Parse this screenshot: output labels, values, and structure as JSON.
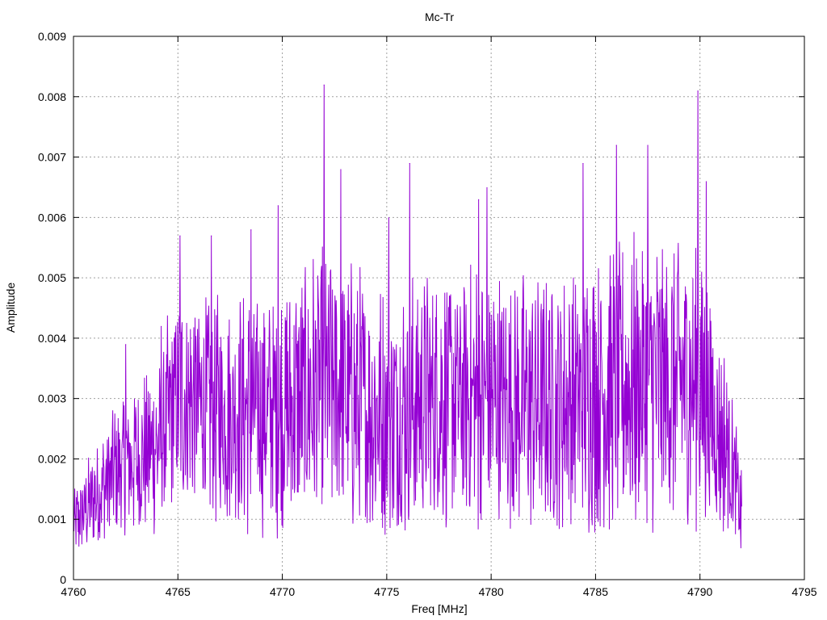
{
  "chart_data": {
    "type": "line",
    "title": "Mc-Tr",
    "xlabel": "Freq [MHz]",
    "ylabel": "Amplitude",
    "xlim": [
      4760,
      4795
    ],
    "ylim": [
      0,
      0.009
    ],
    "xticks": [
      "4760",
      "4765",
      "4770",
      "4775",
      "4780",
      "4785",
      "4790",
      "4795"
    ],
    "yticks": [
      "0",
      "0.001",
      "0.002",
      "0.003",
      "0.004",
      "0.005",
      "0.006",
      "0.007",
      "0.008",
      "0.009"
    ],
    "grid": true,
    "line_color": "#9400d3",
    "series": [
      {
        "x_start": 4760,
        "x_end": 4792,
        "peaks": [
          {
            "x": 4762.5,
            "y": 0.0039
          },
          {
            "x": 4764.2,
            "y": 0.0042
          },
          {
            "x": 4765.1,
            "y": 0.0057
          },
          {
            "x": 4766.6,
            "y": 0.0057
          },
          {
            "x": 4768.5,
            "y": 0.0058
          },
          {
            "x": 4769.8,
            "y": 0.0062
          },
          {
            "x": 4772.0,
            "y": 0.0082
          },
          {
            "x": 4772.8,
            "y": 0.0068
          },
          {
            "x": 4775.1,
            "y": 0.006
          },
          {
            "x": 4776.1,
            "y": 0.0069
          },
          {
            "x": 4779.4,
            "y": 0.0063
          },
          {
            "x": 4779.8,
            "y": 0.0065
          },
          {
            "x": 4784.4,
            "y": 0.0069
          },
          {
            "x": 4786.0,
            "y": 0.0072
          },
          {
            "x": 4787.5,
            "y": 0.0072
          },
          {
            "x": 4789.9,
            "y": 0.0081
          },
          {
            "x": 4790.3,
            "y": 0.0066
          }
        ],
        "envelope": [
          {
            "x": 4760,
            "mean": 0.0009,
            "amp": 0.0006
          },
          {
            "x": 4762,
            "mean": 0.0018,
            "amp": 0.0012
          },
          {
            "x": 4764,
            "mean": 0.0022,
            "amp": 0.0015
          },
          {
            "x": 4765,
            "mean": 0.003,
            "amp": 0.002
          },
          {
            "x": 4767,
            "mean": 0.0028,
            "amp": 0.002
          },
          {
            "x": 4770,
            "mean": 0.0028,
            "amp": 0.0022
          },
          {
            "x": 4772,
            "mean": 0.0032,
            "amp": 0.0025
          },
          {
            "x": 4775,
            "mean": 0.0027,
            "amp": 0.0022
          },
          {
            "x": 4777,
            "mean": 0.003,
            "amp": 0.0022
          },
          {
            "x": 4780,
            "mean": 0.003,
            "amp": 0.0023
          },
          {
            "x": 4783,
            "mean": 0.0029,
            "amp": 0.0021
          },
          {
            "x": 4785,
            "mean": 0.0031,
            "amp": 0.0024
          },
          {
            "x": 4788,
            "mean": 0.0033,
            "amp": 0.0025
          },
          {
            "x": 4790,
            "mean": 0.0032,
            "amp": 0.0025
          },
          {
            "x": 4791.5,
            "mean": 0.002,
            "amp": 0.0014
          },
          {
            "x": 4792,
            "mean": 0.001,
            "amp": 0.0008
          }
        ]
      }
    ]
  }
}
